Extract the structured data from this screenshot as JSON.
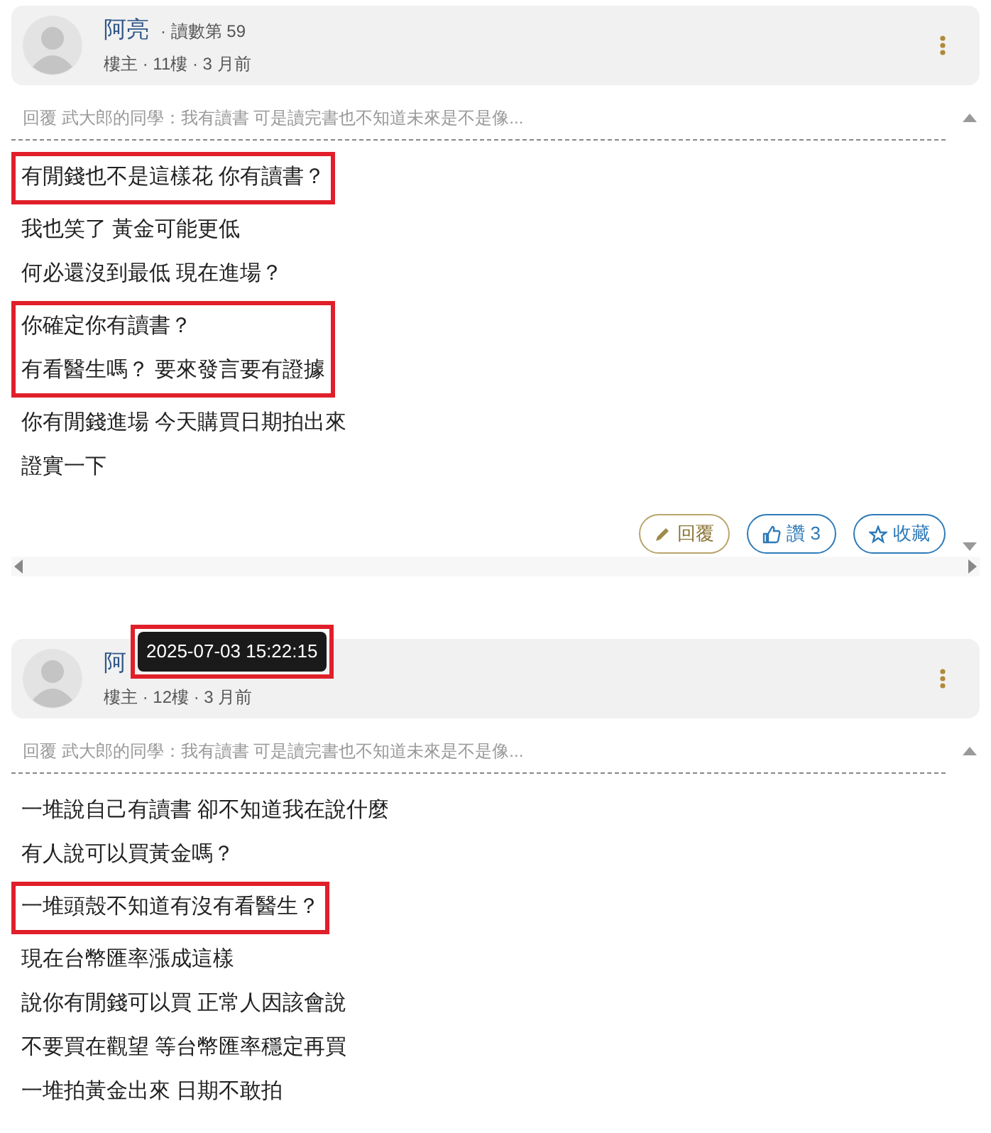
{
  "posts": [
    {
      "author": "阿亮",
      "reads": "· 讀數第 59",
      "meta": "樓主 · 11樓 ·  3 月前",
      "reply_to": "回覆 武大郎的同學：我有讀書 可是讀完書也不知道未來是不是像...",
      "groups": [
        {
          "highlighted": true,
          "lines": [
            "有閒錢也不是這樣花 你有讀書？"
          ]
        },
        {
          "highlighted": false,
          "lines": [
            "我也笑了 黃金可能更低",
            "何必還沒到最低 現在進場？"
          ]
        },
        {
          "highlighted": true,
          "lines": [
            "你確定你有讀書？",
            "有看醫生嗎？ 要來發言要有證據"
          ]
        },
        {
          "highlighted": false,
          "lines": [
            "你有閒錢進場 今天購買日期拍出來",
            "證實一下"
          ]
        }
      ],
      "actions": [
        {
          "kind": "reply",
          "label": "回覆"
        },
        {
          "kind": "like",
          "label": "讚 3"
        },
        {
          "kind": "save",
          "label": "收藏"
        }
      ]
    },
    {
      "author": "阿",
      "meta": "樓主 · 12樓 ·  3 月前",
      "tooltip": "2025-07-03 15:22:15",
      "reply_to": "回覆 武大郎的同學：我有讀書 可是讀完書也不知道未來是不是像...",
      "groups": [
        {
          "highlighted": false,
          "lines": [
            "一堆說自己有讀書 卻不知道我在說什麼",
            "有人說可以買黃金嗎？"
          ]
        },
        {
          "highlighted": true,
          "lines": [
            "一堆頭殼不知道有沒有看醫生？"
          ]
        },
        {
          "highlighted": false,
          "lines": [
            "現在台幣匯率漲成這樣",
            "說你有閒錢可以買 正常人因該會說",
            "不要買在觀望 等台幣匯率穩定再買",
            "一堆拍黃金出來 日期不敢拍"
          ]
        }
      ]
    }
  ]
}
